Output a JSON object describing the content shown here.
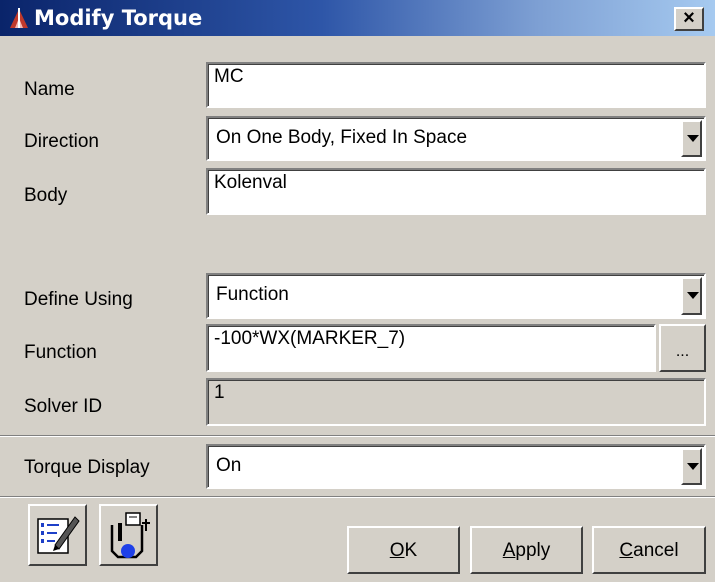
{
  "window": {
    "title": "Modify Torque",
    "close_glyph": "×",
    "icon": "torque-app-icon"
  },
  "fields": {
    "name": {
      "label": "Name",
      "value": "MC"
    },
    "direction": {
      "label": "Direction",
      "value": "On One Body, Fixed In Space"
    },
    "body": {
      "label": "Body",
      "value": "Kolenval"
    },
    "define_using": {
      "label": "Define Using",
      "value": "Function"
    },
    "function": {
      "label": "Function",
      "value": "-100*WX(MARKER_7)",
      "browse_label": "..."
    },
    "solver_id": {
      "label": "Solver ID",
      "value": "1"
    },
    "torque_display": {
      "label": "Torque Display",
      "value": "On"
    }
  },
  "buttons": {
    "ok": {
      "mnemonic": "O",
      "rest": "K"
    },
    "apply": {
      "mnemonic": "A",
      "rest": "pply"
    },
    "cancel": {
      "mnemonic": "C",
      "rest": "ancel"
    }
  },
  "toolbar": {
    "icons": [
      "edit-properties-icon",
      "measure-icon"
    ]
  },
  "colors": {
    "title_start": "#0a246a",
    "title_end": "#a6caf0",
    "face": "#d4d0c8"
  }
}
